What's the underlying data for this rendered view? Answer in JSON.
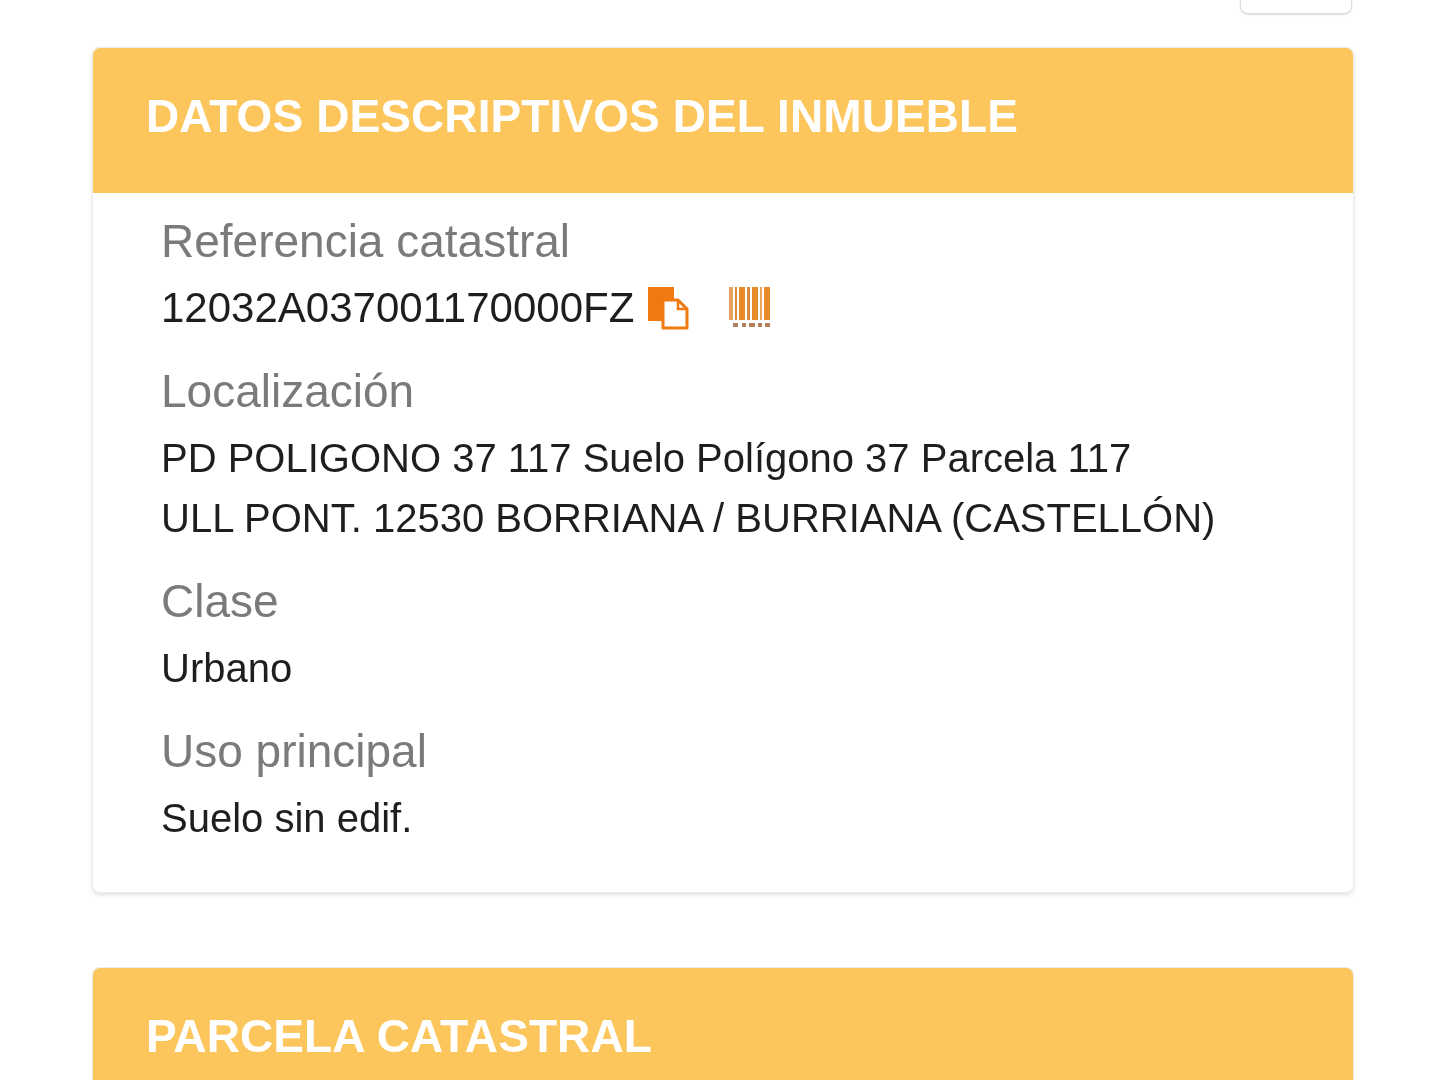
{
  "sections": [
    {
      "title": "DATOS DESCRIPTIVOS DEL INMUEBLE",
      "fields": [
        {
          "kind": "reference",
          "label": "Referencia catastral",
          "value_lines": [
            "12032A037001170000FZ"
          ]
        },
        {
          "kind": "text",
          "label": "Localización",
          "value_lines": [
            "PD POLIGONO 37 117 Suelo Polígono 37 Parcela 117",
            "ULL PONT. 12530 BORRIANA / BURRIANA (CASTELLÓN)"
          ]
        },
        {
          "kind": "text",
          "label": "Clase",
          "value_lines": [
            "Urbano"
          ]
        },
        {
          "kind": "text",
          "label": "Uso principal",
          "value_lines": [
            "Suelo sin edif."
          ]
        }
      ]
    },
    {
      "title": "PARCELA CATASTRAL"
    }
  ]
}
